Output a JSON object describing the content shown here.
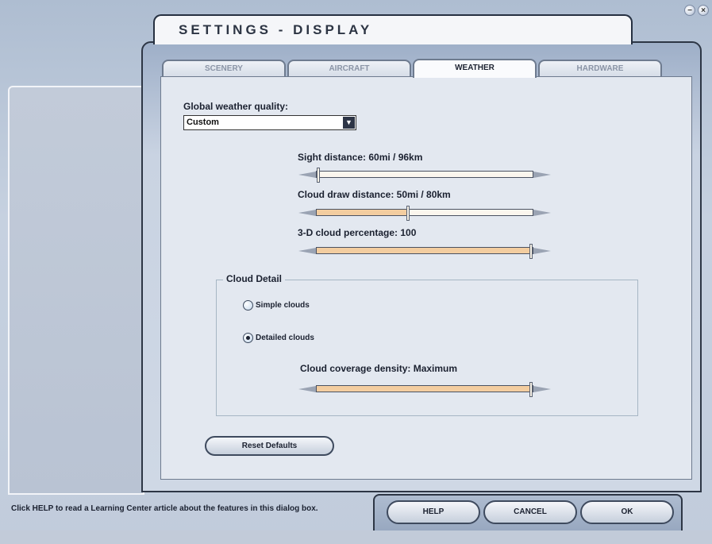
{
  "window": {
    "title": "SETTINGS - DISPLAY"
  },
  "tabs": [
    {
      "label": "SCENERY",
      "active": false
    },
    {
      "label": "AIRCRAFT",
      "active": false
    },
    {
      "label": "WEATHER",
      "active": true
    },
    {
      "label": "HARDWARE",
      "active": false
    }
  ],
  "weather": {
    "quality_label": "Global weather quality:",
    "quality_value": "Custom",
    "sight_label": "Sight distance: 60mi / 96km",
    "sight_level": 0.0,
    "cloud_draw_label": "Cloud draw distance: 50mi / 80km",
    "cloud_draw_level": 0.42,
    "cloud_pct_label": "3-D cloud percentage: 100",
    "cloud_pct_level": 1.0
  },
  "cloud_detail": {
    "title": "Cloud Detail",
    "simple_label": "Simple clouds",
    "simple_selected": false,
    "detailed_label": "Detailed clouds",
    "detailed_selected": true,
    "density_label": "Cloud coverage density: Maximum",
    "density_level": 1.0
  },
  "buttons": {
    "reset": "Reset Defaults",
    "help": "HELP",
    "cancel": "CANCEL",
    "ok": "OK"
  },
  "footer": {
    "help_text": "Click HELP to read a Learning Center article about the features in this dialog box."
  },
  "icons": {
    "minimize": "minimize-icon",
    "close": "close-icon",
    "dropdown": "chevron-down-icon"
  },
  "colors": {
    "slider_fill": "#f3cda0",
    "frame_border": "#2d3645",
    "pane_bg": "#e3e8f0"
  }
}
